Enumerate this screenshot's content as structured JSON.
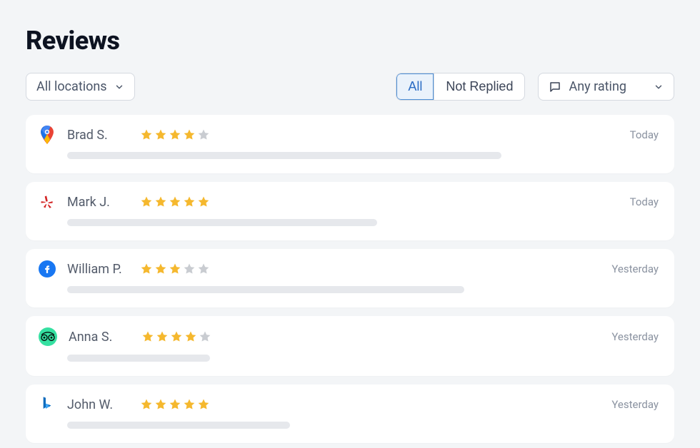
{
  "title": "Reviews",
  "filters": {
    "location_label": "All locations",
    "tabs": {
      "all": "All",
      "not_replied": "Not Replied",
      "active": "all"
    },
    "rating_label": "Any rating"
  },
  "reviews": [
    {
      "platform": "google",
      "name": "Brad S.",
      "stars": 4,
      "time": "Today",
      "bar_pct": 70
    },
    {
      "platform": "yelp",
      "name": "Mark J.",
      "stars": 5,
      "time": "Today",
      "bar_pct": 50
    },
    {
      "platform": "facebook",
      "name": "William P.",
      "stars": 3,
      "time": "Yesterday",
      "bar_pct": 64
    },
    {
      "platform": "tripadvisor",
      "name": "Anna S.",
      "stars": 4,
      "time": "Yesterday",
      "bar_pct": 23
    },
    {
      "platform": "bing",
      "name": "John W.",
      "stars": 5,
      "time": "Yesterday",
      "bar_pct": 36
    }
  ]
}
